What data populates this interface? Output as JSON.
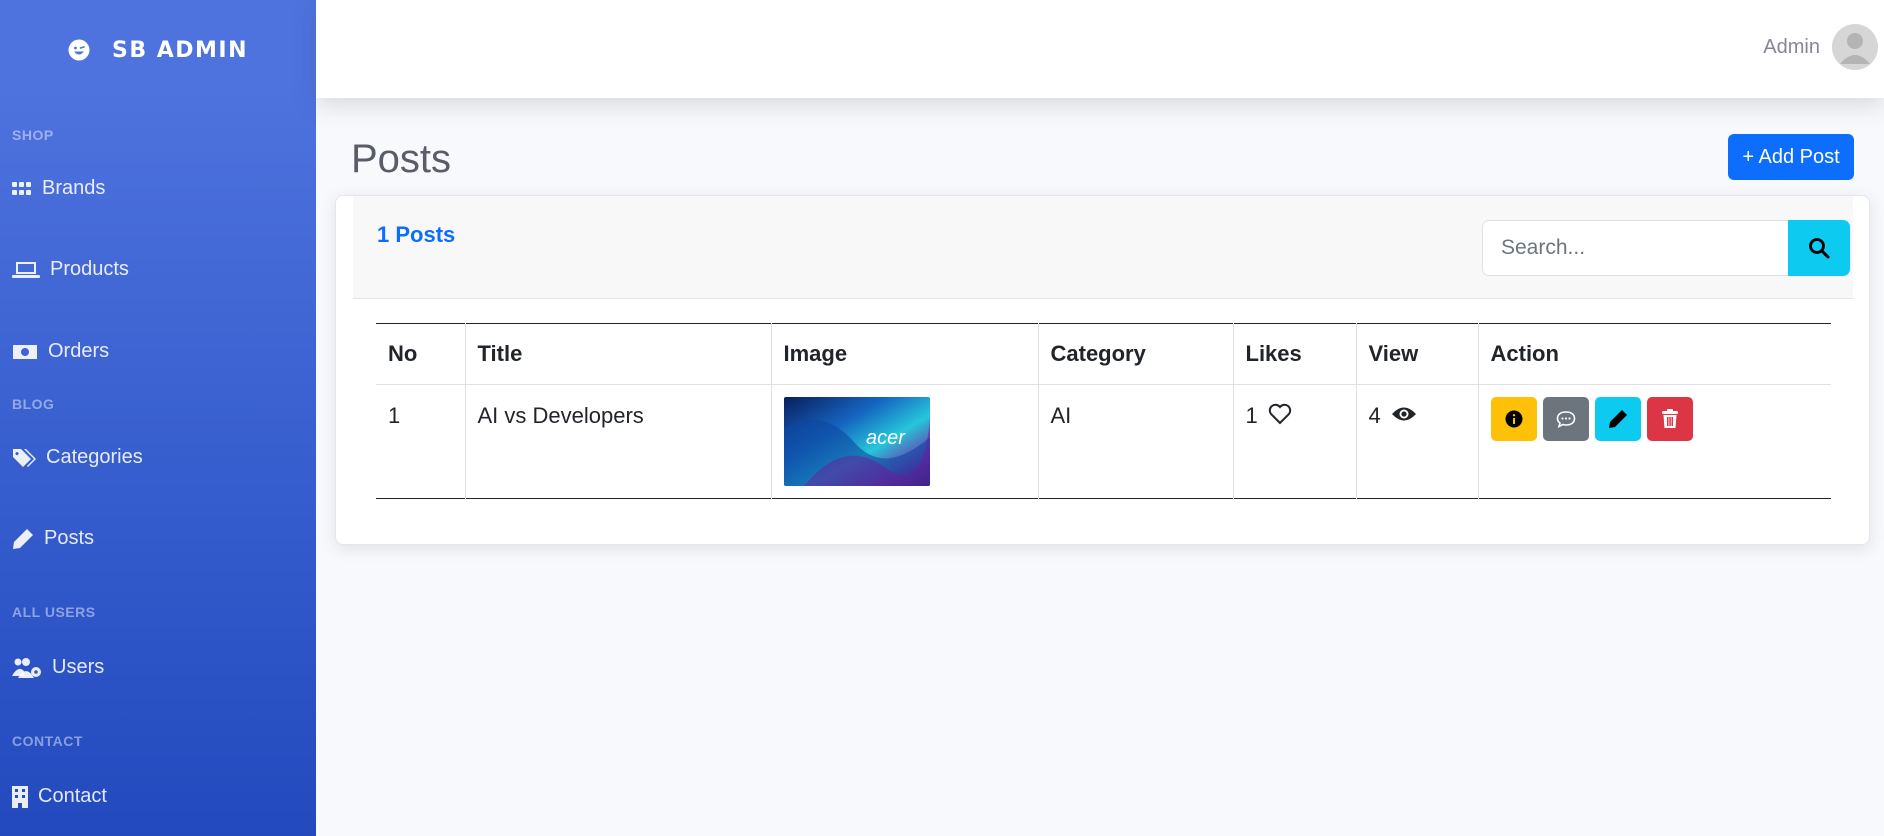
{
  "sidebar": {
    "brand": "SB ADMIN",
    "sections": [
      {
        "heading": "SHOP",
        "items": [
          {
            "label": "Brands",
            "icon": "grid-icon"
          },
          {
            "label": "Products",
            "icon": "laptop-icon"
          },
          {
            "label": "Orders",
            "icon": "money-bill-icon"
          }
        ]
      },
      {
        "heading": "BLOG",
        "items": [
          {
            "label": "Categories",
            "icon": "tags-icon"
          },
          {
            "label": "Posts",
            "icon": "pen-icon"
          }
        ]
      },
      {
        "heading": "ALL USERS",
        "items": [
          {
            "label": "Users",
            "icon": "users-gear-icon"
          }
        ]
      },
      {
        "heading": "CONTACT",
        "items": [
          {
            "label": "Contact",
            "icon": "building-icon"
          }
        ]
      }
    ]
  },
  "topbar": {
    "username": "Admin"
  },
  "page": {
    "title": "Posts",
    "add_button": "+ Add Post"
  },
  "card": {
    "count_label": "1 Posts",
    "search_placeholder": "Search..."
  },
  "table": {
    "headers": [
      "No",
      "Title",
      "Image",
      "Category",
      "Likes",
      "View",
      "Action"
    ],
    "rows": [
      {
        "no": "1",
        "title": "AI vs Developers",
        "image_text": "acer",
        "category": "AI",
        "likes": "1",
        "views": "4"
      }
    ]
  },
  "colors": {
    "sidebar_top": "#4e73df",
    "sidebar_bottom": "#224abe",
    "primary": "#0d6efd",
    "info": "#0dcaf0",
    "warning": "#ffc107",
    "secondary": "#6c757d",
    "danger": "#dc3545"
  }
}
